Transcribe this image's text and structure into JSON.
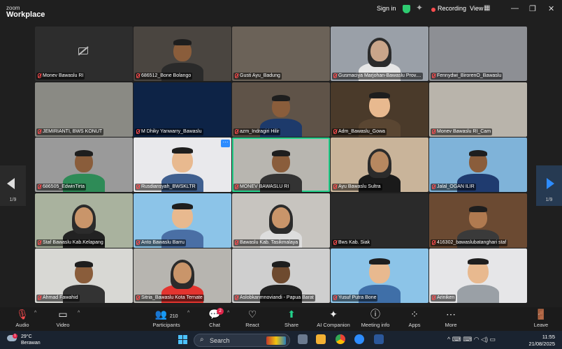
{
  "app": {
    "logo_top": "zoom",
    "logo_bottom": "Workplace"
  },
  "titlebar": {
    "sign_in": "Sign in",
    "recording": "Recording",
    "view": "View",
    "grid_glyph": "▦",
    "minimize": "—",
    "restore": "❐",
    "close": "✕"
  },
  "pager": {
    "left": "1/9",
    "right": "1/9"
  },
  "participants": [
    {
      "name": "Monev Bawaslu RI",
      "bg": "#2d2d2d",
      "cam_off": true
    },
    {
      "name": "686512_Bone Bolango",
      "bg": "#4a4540",
      "skin": "#8a5d3b",
      "shirt": "#2a2a2a"
    },
    {
      "name": "Gusti Ayu_Badung",
      "bg": "#6b6258"
    },
    {
      "name": "Gusmaciya Marjohan-Bawaslu Prov....",
      "bg": "#9aa0a8",
      "skin": "#c9a58a",
      "shirt": "#e6e6e6",
      "hijab": true
    },
    {
      "name": "Fennydwi_BirorenO_Bawaslu",
      "bg": "#8d8f94"
    },
    {
      "name": "JEMIRIANTI, BWS KONUT",
      "bg": "#8a8a84"
    },
    {
      "name": "M Dhiky Yanwarry_Bawaslu",
      "bg": "#0d2346"
    },
    {
      "name": "azm_Indragiri Hilir",
      "bg": "#5f5348",
      "skin": "#8a5d3b",
      "shirt": "#1d3a6b"
    },
    {
      "name": "Adm_Bawaslu_Gowa",
      "bg": "#4a3a2a",
      "skin": "#e8b98f",
      "shirt": "#5a4632",
      "avatar": true
    },
    {
      "name": "Monev Bawaslu RI_Cam",
      "bg": "#b9b4ab"
    },
    {
      "name": "686505_EdwinTirta",
      "bg": "#9a9a9a",
      "skin": "#8a5d3b",
      "shirt": "#2e8b57"
    },
    {
      "name": "Rusdiansyah_BWSKLTR",
      "bg": "#e9e9ec",
      "skin": "#e8b98f",
      "shirt": "#3f5f8f",
      "avatar": true,
      "dots": true
    },
    {
      "name": "MONEV BAWASLU RI",
      "bg": "#b8b6b0",
      "skin": "#8a5d3b",
      "shirt": "#333",
      "active": true
    },
    {
      "name": "Ayu Bawaslu Sultra",
      "bg": "#c9b49a",
      "skin": "#b78860",
      "shirt": "#1a1a1a",
      "hijab": true
    },
    {
      "name": "Jalal_OGAN ILIR",
      "bg": "#7fb3d9",
      "skin": "#8a5d3b",
      "shirt": "#1f3b6f"
    },
    {
      "name": "Staf Bawaslu Kab.Kelapang",
      "bg": "#a9b29e",
      "skin": "#c9956a",
      "shirt": "#222",
      "hijab": true
    },
    {
      "name": "Anto Bawaslu Barru",
      "bg": "#8cc4e8",
      "skin": "#e8b98f",
      "shirt": "#4a6fa5",
      "avatar": true
    },
    {
      "name": "Bawaslu Kab. Tasikmalaya",
      "bg": "#c7c4bf",
      "skin": "#c9956a",
      "shirt": "#ddd",
      "hijab": true
    },
    {
      "name": "Bws Kab. Siak",
      "bg": "#2a2a2a"
    },
    {
      "name": "416302_bawaslubatanghari staf",
      "bg": "#6b4a32",
      "skin": "#b07a50",
      "shirt": "#3a3a3a"
    },
    {
      "name": "Ahmad Fawahid",
      "bg": "#d8d8d4",
      "skin": "#8a5d3b",
      "shirt": "#333"
    },
    {
      "name": "Sitria_Bawaslu Kota Ternate",
      "bg": "#b7b5b0",
      "skin": "#c9956a",
      "shirt": "#e3342f",
      "hijab": true
    },
    {
      "name": "Aslobkanmnoviandi - Papua Barat",
      "bg": "#cfcfcf",
      "skin": "#6e4a2f",
      "shirt": "#222"
    },
    {
      "name": "Yusuf Putra Bone",
      "bg": "#8cc4e8",
      "skin": "#e8b98f",
      "shirt": "#3f6fa8",
      "avatar": true
    },
    {
      "name": "Ariniken",
      "bg": "#e6e6e8",
      "skin": "#e8b98f",
      "shirt": "#9aa0a6",
      "avatar": true
    }
  ],
  "toolbar": {
    "audio": "Audio",
    "video": "Video",
    "participants": "Participants",
    "participants_count": "210",
    "chat": "Chat",
    "chat_badge": "2",
    "react": "React",
    "share": "Share",
    "ai_companion": "AI Companion",
    "meeting_info": "Meeting info",
    "apps": "Apps",
    "more": "More",
    "leave": "Leave"
  },
  "taskbar": {
    "temperature": "29°C",
    "weather": "Berawan",
    "weather_badge": "1",
    "search_placeholder": "Search",
    "time": "11:55",
    "date": "21/08/2025",
    "tray_glyphs": "^  ⌨  ⌨  ◠  ◁)  ▭"
  },
  "colors": {
    "accent": "#2d8cff",
    "active_speaker": "#23d18b",
    "recording": "#ff4d4f",
    "share": "#23d18b"
  }
}
